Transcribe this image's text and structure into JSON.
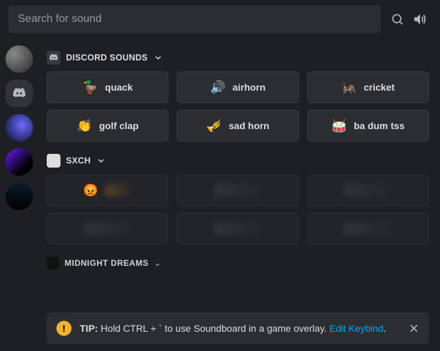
{
  "search": {
    "placeholder": "Search for sound"
  },
  "sections": {
    "discord": {
      "title": "DISCORD SOUNDS",
      "sounds": [
        {
          "emoji": "🦆",
          "label": "quack"
        },
        {
          "emoji": "🔊",
          "label": "airhorn"
        },
        {
          "emoji": "🦗",
          "label": "cricket"
        },
        {
          "emoji": "👏",
          "label": "golf clap"
        },
        {
          "emoji": "🎺",
          "label": "sad horn"
        },
        {
          "emoji": "🥁",
          "label": "ba dum tss"
        }
      ]
    },
    "sxch": {
      "title": "SXCH",
      "locked": [
        {
          "emoji": "😡"
        },
        {},
        {},
        {},
        {},
        {}
      ]
    },
    "midnight": {
      "title": "MIDNIGHT DREAMS"
    }
  },
  "tip": {
    "prefix": "TIP:",
    "body": "Hold CTRL + ` to use Soundboard in a game overlay.",
    "link": "Edit Keybind",
    "suffix": "."
  }
}
